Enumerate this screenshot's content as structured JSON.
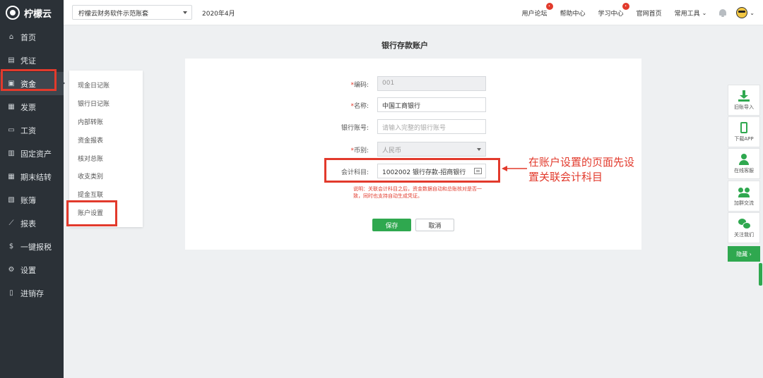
{
  "app": {
    "name": "柠檬云"
  },
  "sidebar": {
    "items": [
      {
        "label": "首页",
        "icon": "home-icon"
      },
      {
        "label": "凭证",
        "icon": "voucher-icon"
      },
      {
        "label": "资金",
        "icon": "fund-icon"
      },
      {
        "label": "发票",
        "icon": "invoice-icon"
      },
      {
        "label": "工资",
        "icon": "salary-icon"
      },
      {
        "label": "固定资产",
        "icon": "assets-icon"
      },
      {
        "label": "期末结转",
        "icon": "calendar-icon"
      },
      {
        "label": "账簿",
        "icon": "book-icon"
      },
      {
        "label": "报表",
        "icon": "chart-icon"
      },
      {
        "label": "一键报税",
        "icon": "dollar-icon"
      },
      {
        "label": "设置",
        "icon": "gear-icon"
      },
      {
        "label": "进销存",
        "icon": "inventory-icon"
      }
    ]
  },
  "topbar": {
    "company": "柠檬云财务软件示范账套",
    "period": "2020年4月",
    "links": [
      "用户论坛",
      "帮助中心",
      "学习中心",
      "官网首页",
      "常用工具"
    ]
  },
  "submenu": {
    "items": [
      "现金日记账",
      "银行日记账",
      "内部转账",
      "资金报表",
      "核对总账",
      "收支类别",
      "提金互联",
      "账户设置"
    ]
  },
  "form": {
    "title": "银行存款账户",
    "code_label": "编码:",
    "code_value": "001",
    "name_label": "名称:",
    "name_value": "中国工商银行",
    "account_label": "银行账号:",
    "account_placeholder": "请输入完整的银行账号",
    "currency_label": "币别:",
    "currency_value": "人民币",
    "subject_label": "会计科目:",
    "subject_value": "1002002 银行存款-招商银行",
    "hint": "说明：关联会计科目之后，资金数据自动和总账核对是否一致，同时也支持自动生成凭证。",
    "save": "保存",
    "cancel": "取消"
  },
  "annotation": "在账户设置的页面先设置关联会计科目",
  "right_toolbar": {
    "items": [
      "旧账导入",
      "下载APP",
      "在线客服",
      "加群交流",
      "关注我们"
    ],
    "collapse": "隐藏 ›"
  },
  "colors": {
    "sidebar": "#2b3137",
    "accent_green": "#2fa84f",
    "highlight_red": "#e23a2c"
  }
}
